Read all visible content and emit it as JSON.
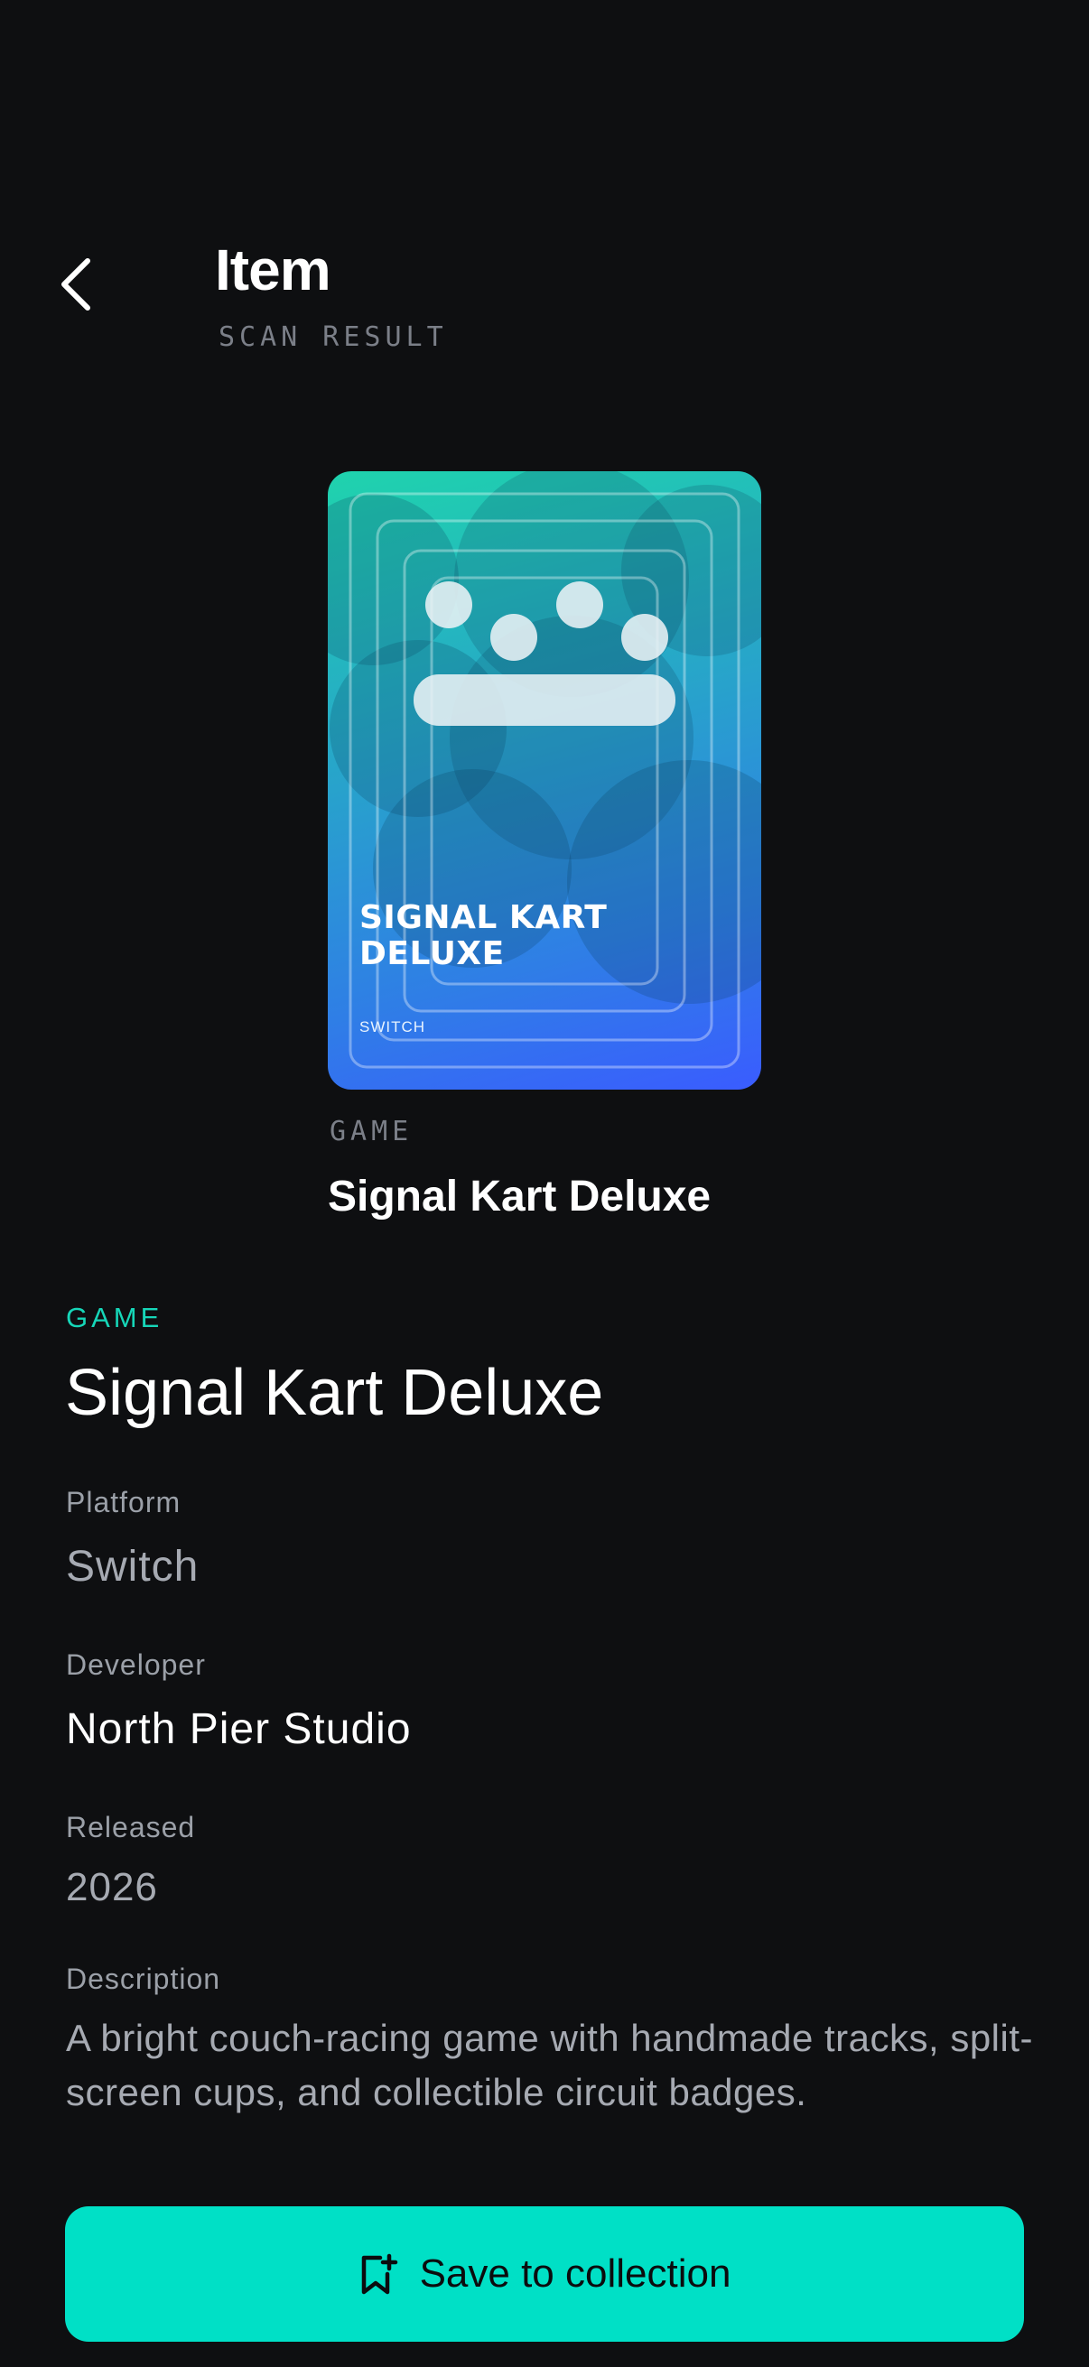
{
  "header": {
    "title": "Item",
    "subtitle": "SCAN RESULT",
    "back_icon": "chevron-left-icon"
  },
  "cover": {
    "title": "SIGNAL KART DELUXE",
    "platform": "SWITCH",
    "category": "GAME",
    "name": "Signal Kart Deluxe",
    "gradient_colors": [
      "#1fd3ad",
      "#27a6c9",
      "#2f7ee6",
      "#3a5cff"
    ]
  },
  "details": {
    "category": "GAME",
    "title": "Signal Kart Deluxe",
    "fields": [
      {
        "label": "Platform",
        "value": "Switch"
      },
      {
        "label": "Developer",
        "value": "North Pier Studio"
      },
      {
        "label": "Released",
        "value": "2026"
      },
      {
        "label": "Description",
        "value": "A bright couch-racing game with handmade tracks, split-screen cups, and collectible circuit badges."
      }
    ]
  },
  "cta": {
    "label": "Save to collection",
    "icon": "bookmark-plus-icon",
    "color": "#00e0c6"
  },
  "colors": {
    "background": "#0e0f11",
    "accent": "#16d6b8",
    "muted_text": "#9ba0a8"
  }
}
